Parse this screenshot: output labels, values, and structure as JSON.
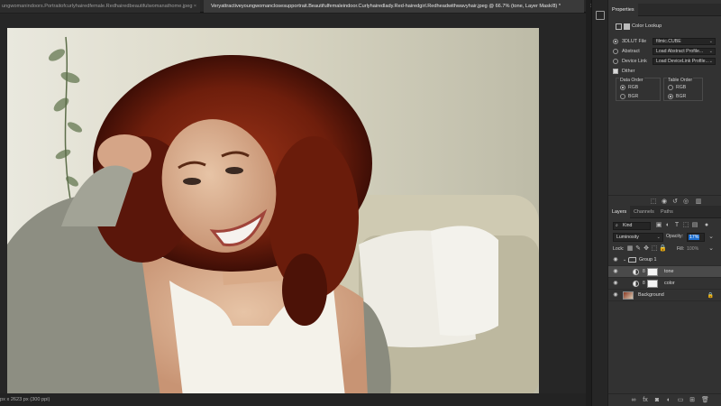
{
  "tabs": [
    {
      "label": "ungwomanindoors.Portraitofcurlyhairedfemale.Redhairedbeautifulwomanathome.jpeg",
      "close": "×"
    },
    {
      "label": "Veryattractiveyoungwomanclosesupportrait.Beautifulfemaleindoor.Curlyhairedlady.Red-hairedgirl.Redheadwithwavyhair.jpeg @ 66.7% (tone, Layer Mask/8) *"
    }
  ],
  "tab_overflow": "»",
  "status_text": "px x 2623 px (300 ppi)",
  "properties": {
    "tab_label": "Properties",
    "header_label": "Color Lookup",
    "rows": [
      {
        "label": "3DLUT File",
        "value": "filmic.CUBE",
        "selected": true
      },
      {
        "label": "Abstract",
        "value": "Load Abstract Profile...",
        "selected": false
      },
      {
        "label": "Device Link",
        "value": "Load DeviceLink Profile...",
        "selected": false
      }
    ],
    "dither_label": "Dither",
    "data_order": {
      "title": "Data Order",
      "options": [
        "RGB",
        "BGR"
      ],
      "selected": "RGB"
    },
    "table_order": {
      "title": "Table Order",
      "options": [
        "RGB",
        "BGR"
      ],
      "selected": "BGR"
    }
  },
  "layers": {
    "tabs": [
      "Layers",
      "Channels",
      "Paths"
    ],
    "filter_kind": "Kind",
    "blend_mode": "Luminosity",
    "opacity_label": "Opacity:",
    "opacity_value": "17%",
    "lock_label": "Lock:",
    "fill_label": "Fill:",
    "fill_value": "100%",
    "items": [
      {
        "name": "Group 1",
        "type": "group"
      },
      {
        "name": "tone",
        "type": "adjustment",
        "selected": true
      },
      {
        "name": "color",
        "type": "adjustment"
      },
      {
        "name": "Background",
        "type": "image"
      }
    ]
  }
}
